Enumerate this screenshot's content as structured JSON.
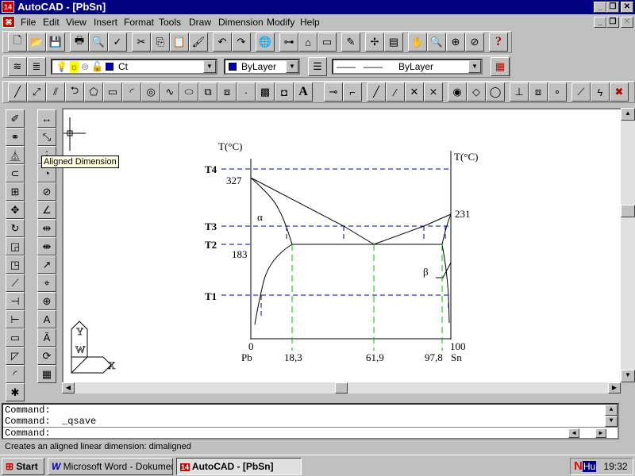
{
  "window": {
    "title": "AutoCAD - [PbSn]",
    "app_icon": "autocad-r14-icon"
  },
  "menu": [
    "File",
    "Edit",
    "View",
    "Insert",
    "Format",
    "Tools",
    "Draw",
    "Dimension",
    "Modify",
    "Help"
  ],
  "standard_toolbar": [
    [
      "new-icon",
      "open-icon",
      "save-icon"
    ],
    [
      "print-icon",
      "print-preview-icon",
      "spelling-icon"
    ],
    [
      "cut-icon",
      "copy-icon",
      "paste-icon",
      "match-properties-icon"
    ],
    [
      "undo-icon",
      "redo-icon"
    ],
    [
      "browse-web-icon"
    ],
    [
      "object-snap-icon",
      "ucs-icon",
      "inquiry-icon"
    ],
    [
      "redraw-icon"
    ],
    [
      "aerial-view-icon",
      "named-views-icon"
    ],
    [
      "pan-icon",
      "zoom-realtime-icon",
      "zoom-window-icon",
      "zoom-previous-icon"
    ],
    [
      "help-icon"
    ]
  ],
  "properties_toolbar": {
    "layer": "Ct",
    "color": "ByLayer",
    "linetype": "ByLayer",
    "layer_color": "#0000c0"
  },
  "draw_toolbar": [
    "line-icon",
    "construction-line-icon",
    "multiline-icon",
    "polyline-icon",
    "polygon-icon",
    "rectangle-icon",
    "arc-icon",
    "circle-icon",
    "spline-icon",
    "ellipse-icon",
    "insert-block-icon",
    "make-block-icon",
    "point-icon",
    "hatch-icon",
    "region-icon",
    "text-icon"
  ],
  "osnap_toolbar": [
    [
      "tracking-icon",
      "from-icon"
    ],
    [
      "snap-endpoint-icon",
      "snap-midpoint-icon",
      "snap-intersection-icon",
      "snap-apparent-intersection-icon"
    ],
    [
      "snap-center-icon",
      "snap-quadrant-icon",
      "snap-tangent-icon"
    ],
    [
      "snap-perpendicular-icon",
      "snap-insertion-icon",
      "snap-node-icon"
    ],
    [
      "snap-nearest-icon",
      "snap-quick-icon",
      "snap-none-icon"
    ]
  ],
  "modify_toolbar": [
    "erase-icon",
    "copy-object-icon",
    "mirror-icon",
    "offset-icon",
    "array-icon",
    "move-icon",
    "rotate-icon",
    "scale-icon",
    "stretch-icon",
    "lengthen-icon",
    "trim-icon",
    "extend-icon",
    "break-icon",
    "chamfer-icon",
    "fillet-icon",
    "explode-icon"
  ],
  "dimension_toolbar": [
    "linear-dimension-icon",
    "aligned-dimension-icon",
    "ordinate-dimension-icon",
    "radius-dimension-icon",
    "diameter-dimension-icon",
    "angular-dimension-icon",
    "baseline-dimension-icon",
    "continue-dimension-icon",
    "leader-icon",
    "tolerance-icon",
    "center-mark-icon",
    "dimension-edit-icon",
    "dimension-text-edit-icon",
    "dimension-update-icon",
    "dimension-style-icon"
  ],
  "tooltip": "Aligned Dimension",
  "drawing": {
    "left_axis_label": "T(°C)",
    "right_axis_label": "T(°C)",
    "temps": [
      "T4",
      "T3",
      "T2",
      "T1"
    ],
    "left_values": [
      "327",
      "183"
    ],
    "right_value": "231",
    "x_ticks": [
      "0",
      "100"
    ],
    "x_labels": [
      "Pb",
      "18,3",
      "61,9",
      "97,8",
      "Sn"
    ],
    "phase_alpha": "α",
    "phase_beta": "β",
    "colors": {
      "dashed": "#0000a0",
      "eutectic": "#00c000"
    }
  },
  "command": {
    "history": [
      "Command:",
      "Command:  _qsave"
    ],
    "prompt": "Command:"
  },
  "status": "Creates an aligned linear dimension:  dimaligned",
  "taskbar": {
    "start": "Start",
    "tasks": [
      "Microsoft Word - Dokumen...",
      "AutoCAD - [PbSn]"
    ],
    "lang": "Hu",
    "clock": "19:32"
  }
}
